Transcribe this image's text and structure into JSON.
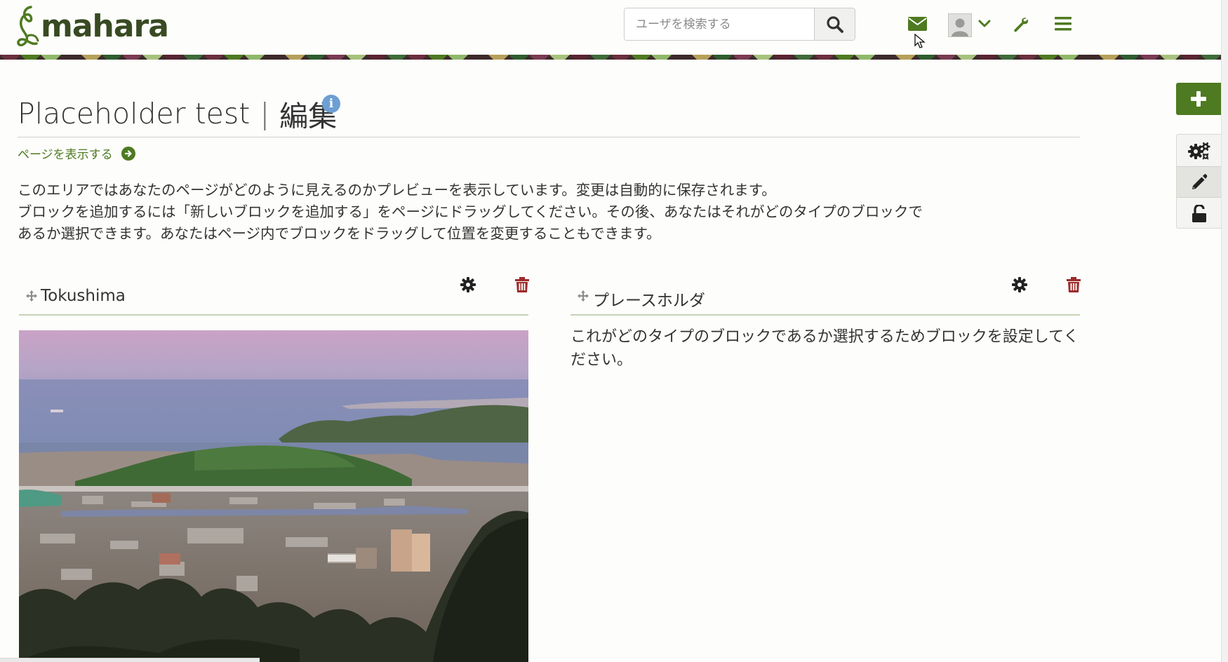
{
  "header": {
    "logo_text": "mahara",
    "search": {
      "placeholder": "ユーザを検索する",
      "value": ""
    },
    "icons": [
      "mail-icon",
      "avatar",
      "chevron-down-icon",
      "wrench-icon",
      "hamburger-icon"
    ]
  },
  "page": {
    "title": "Placeholder test",
    "separator": "|",
    "mode": "編集",
    "view_link": "ページを表示する",
    "intro": [
      "このエリアではあなたのページがどのように見えるのかプレビューを表示しています。変更は自動的に保存されます。",
      "ブロックを追加するには「新しいブロックを追加する」をページにドラッグしてください。その後、あなたはそれがどのタイプのブロックで",
      "あるか選択できます。あなたはページ内でブロックをドラッグして位置を変更することもできます。"
    ]
  },
  "blocks": [
    {
      "title": "Tokushima",
      "type": "image"
    },
    {
      "title": "プレースホルダ",
      "body": "これがどのタイプのブロックであるか選択するためブロックを設定してください。"
    }
  ],
  "colors": {
    "brand_green": "#4e7a21",
    "logo_dark": "#384a22",
    "trash_red": "#9c2b2b",
    "info_blue": "#6d9fd3"
  }
}
